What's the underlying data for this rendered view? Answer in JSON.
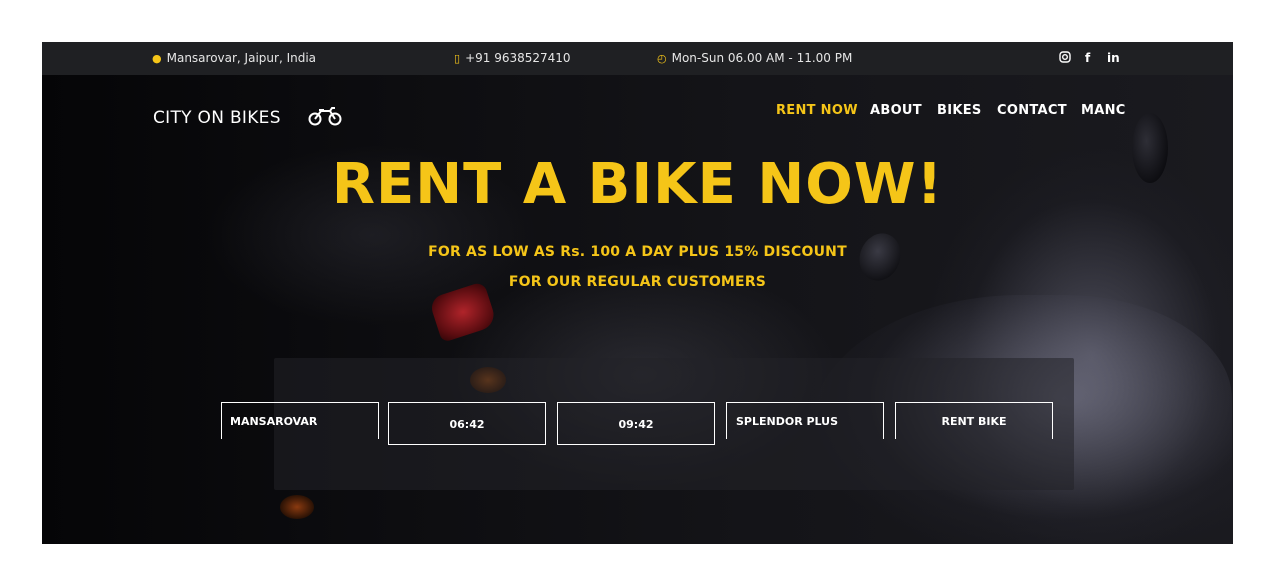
{
  "topbar": {
    "location": "Mansarovar, Jaipur, India",
    "phone": "+91 9638527410",
    "hours": "Mon-Sun 06.00 AM - 11.00 PM",
    "social": [
      "instagram-icon",
      "facebook-icon",
      "linkedin-icon"
    ],
    "facebook_glyph": "f",
    "linkedin_glyph": "in"
  },
  "brand": {
    "name": "CITY ON BIKES",
    "icon": "motorcycle-icon"
  },
  "nav": {
    "items": [
      "RENT NOW",
      "ABOUT",
      "BIKES",
      "CONTACT",
      "MANC"
    ]
  },
  "hero": {
    "headline": "RENT A BIKE NOW!",
    "subline1": "FOR AS LOW AS Rs. 100 A DAY PLUS 15% DISCOUNT",
    "subline2": "FOR OUR REGULAR CUSTOMERS"
  },
  "booking": {
    "location": "MANSAROVAR",
    "pickup_time": "06:42",
    "drop_time": "09:42",
    "bike": "SPLENDOR PLUS",
    "submit": "RENT BIKE"
  },
  "colors": {
    "accent": "#f5c518",
    "topbar_bg": "#1f2023",
    "hero_bg": "#070709"
  }
}
